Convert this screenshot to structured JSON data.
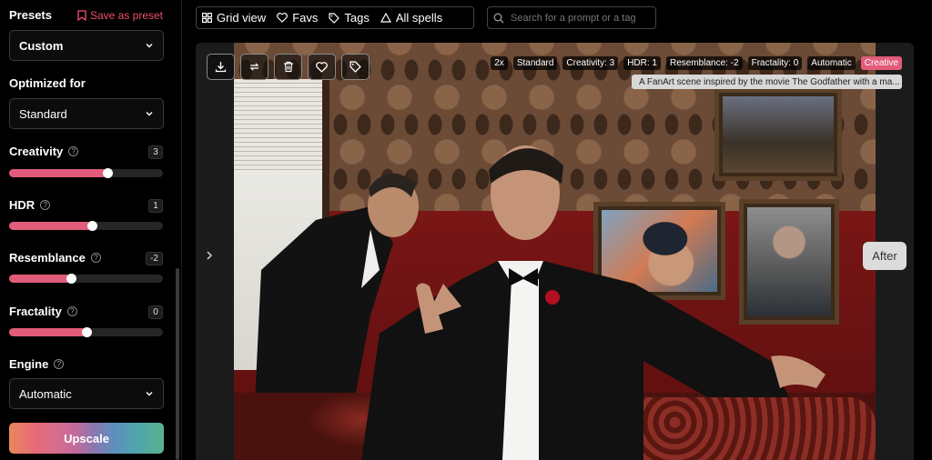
{
  "sidebar": {
    "presets_label": "Presets",
    "save_preset_label": "Save as preset",
    "preset_value": "Custom",
    "optimized_label": "Optimized for",
    "optimized_value": "Standard",
    "sliders": [
      {
        "label": "Creativity",
        "value": "3",
        "fraction": 0.64
      },
      {
        "label": "HDR",
        "value": "1",
        "fraction": 0.54
      },
      {
        "label": "Resemblance",
        "value": "-2",
        "fraction": 0.4
      },
      {
        "label": "Fractality",
        "value": "0",
        "fraction": 0.5
      }
    ],
    "engine_label": "Engine",
    "engine_value": "Automatic",
    "upscale_label": "Upscale"
  },
  "topbar": {
    "grid_view": "Grid view",
    "favs": "Favs",
    "tags": "Tags",
    "all_spells": "All spells",
    "search_placeholder": "Search for a prompt or a tag"
  },
  "viewer": {
    "tags": [
      "2x",
      "Standard",
      "Creativity: 3",
      "HDR: 1",
      "Resemblance: -2",
      "Fractality: 0",
      "Automatic",
      "Creative"
    ],
    "prompt": "A FanArt scene inspired by the movie The Godfather with a ma...",
    "after_label": "After"
  },
  "colors": {
    "accent": "#e25c79",
    "slider_track": "#262626"
  },
  "icons": {
    "toolbar": [
      "download-icon",
      "repeat-icon",
      "trash-icon",
      "heart-icon",
      "tag-icon"
    ]
  }
}
